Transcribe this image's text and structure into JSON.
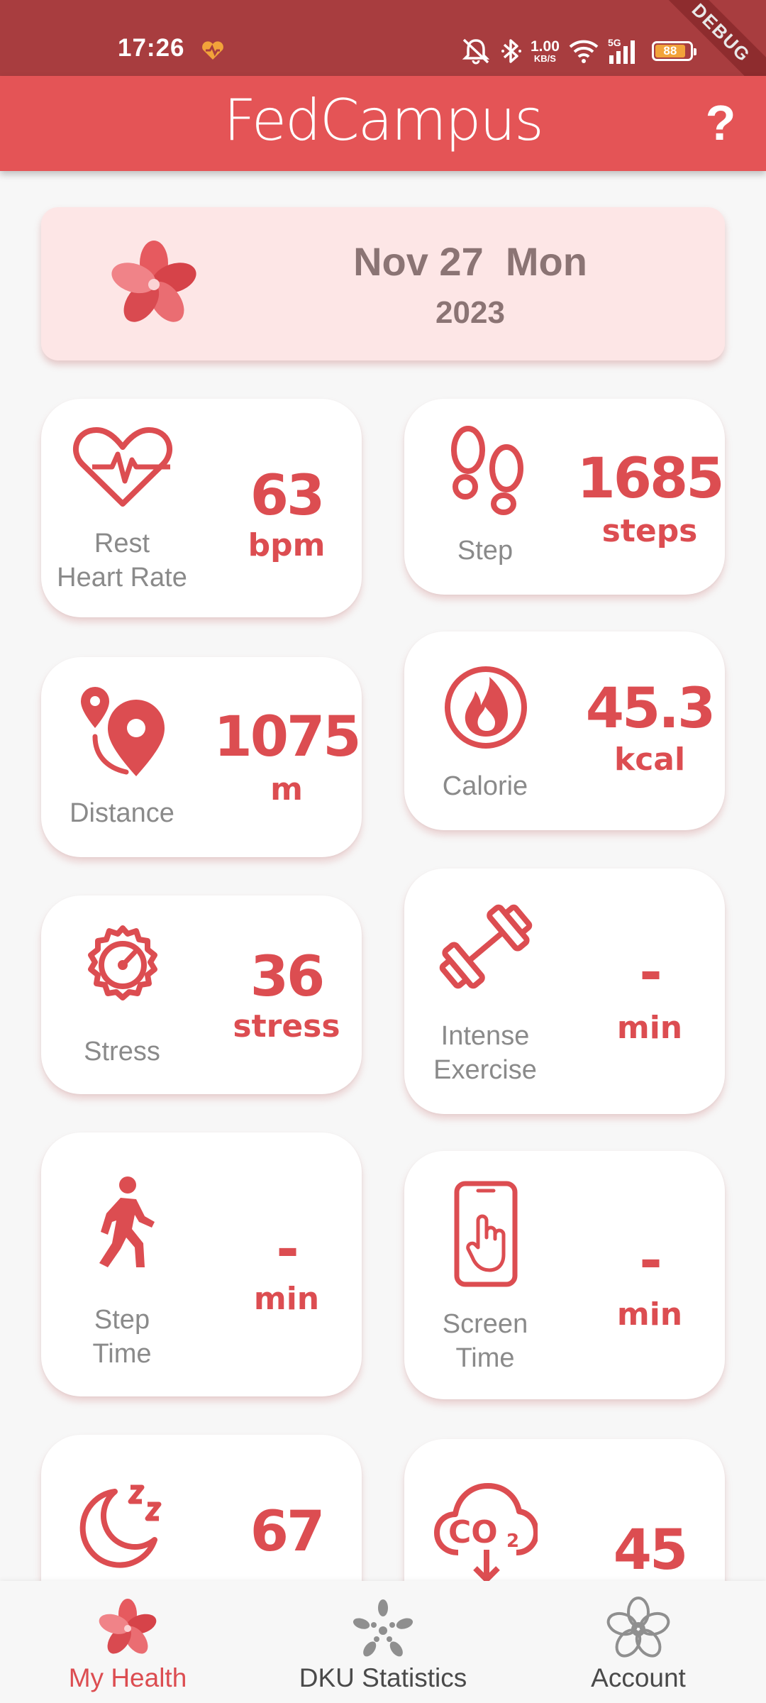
{
  "status_bar": {
    "time": "17:26",
    "network_speed_value": "1.00",
    "network_speed_unit": "KB/S",
    "network_type": "5G",
    "battery_percent": "88",
    "battery_level": 0.88,
    "debug_banner": "DEBUG",
    "icons": [
      "heart-icon",
      "mute-icon",
      "bluetooth-icon",
      "wifi-icon",
      "cellular-signal-icon",
      "battery-icon"
    ]
  },
  "app_bar": {
    "title": "FedCampus",
    "help_label": "?"
  },
  "date_card": {
    "date_line": "Nov 27  Mon",
    "year": "2023"
  },
  "metrics": [
    {
      "label": "Rest\nHeart Rate",
      "value": "63",
      "unit": "bpm",
      "icon": "heart-rate-icon"
    },
    {
      "label": "Step",
      "value": "1685",
      "unit": "steps",
      "icon": "footprints-icon"
    },
    {
      "label": "Distance",
      "value": "1075",
      "unit": "m",
      "icon": "distance-pin-icon"
    },
    {
      "label": "Calorie",
      "value": "45.3",
      "unit": "kcal",
      "icon": "flame-icon"
    },
    {
      "label": "Stress",
      "value": "36",
      "unit": "stress",
      "icon": "stress-gauge-icon"
    },
    {
      "label": "Intense\nExercise",
      "value": "-",
      "unit": "min",
      "icon": "dumbbell-icon"
    },
    {
      "label": "Step\nTime",
      "value": "-",
      "unit": "min",
      "icon": "walking-person-icon"
    },
    {
      "label": "Screen\nTime",
      "value": "-",
      "unit": "min",
      "icon": "phone-touch-icon"
    },
    {
      "label": "",
      "value": "67",
      "unit": "",
      "icon": "sleep-moon-icon"
    },
    {
      "label": "",
      "value": "45",
      "unit": "",
      "icon": "co2-cloud-icon"
    }
  ],
  "bottom_nav": [
    {
      "label": "My Health",
      "icon": "flower-logo-icon",
      "active": true
    },
    {
      "label": "DKU Statistics",
      "icon": "dots-flower-icon",
      "active": false
    },
    {
      "label": "Account",
      "icon": "account-flower-icon",
      "active": false
    }
  ],
  "colors": {
    "status_bar": "#a83d3f",
    "app_bar": "#e45456",
    "accent": "#dc4d51",
    "date_card_bg": "#fde6e6",
    "label_gray": "#8a8a8a"
  }
}
